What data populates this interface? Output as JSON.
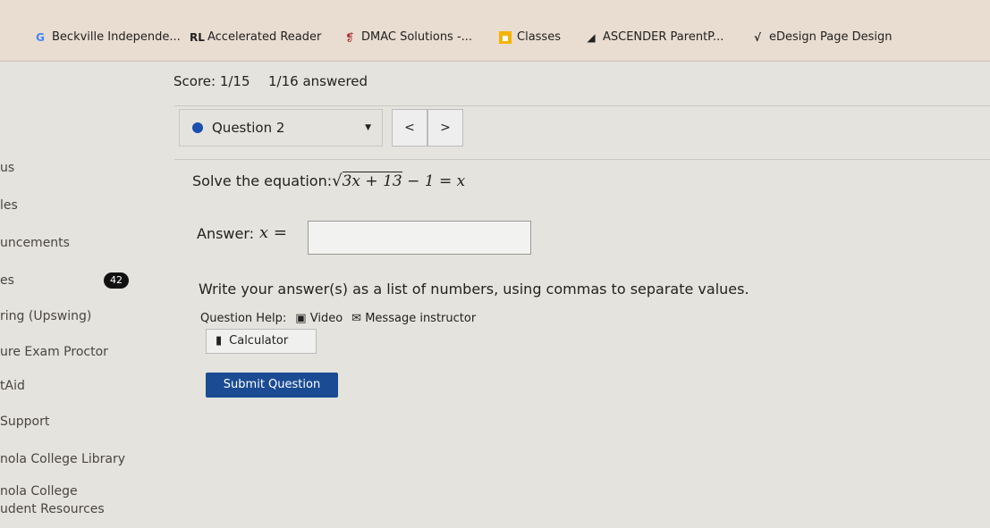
{
  "bookmarks": [
    {
      "label": "Beckville Independe...",
      "icon": "google-icon"
    },
    {
      "label": "Accelerated Reader",
      "icon": "rl-icon"
    },
    {
      "label": "DMAC Solutions -...",
      "icon": "dmac-icon"
    },
    {
      "label": "Classes",
      "icon": "classroom-icon"
    },
    {
      "label": "ASCENDER ParentP...",
      "icon": "ascender-icon"
    },
    {
      "label": "eDesign Page Design",
      "icon": "sqrt-icon"
    }
  ],
  "sidebar": {
    "items": [
      "us",
      "les",
      "uncements",
      "es",
      "ring (Upswing)",
      "ure Exam Proctor",
      "tAid",
      "Support",
      "nola College Library",
      "nola College",
      "udent Resources"
    ],
    "badge": "42"
  },
  "quiz": {
    "score": "Score: 1/15",
    "answered": "1/16 answered",
    "question": "Question 2",
    "prev": "<",
    "next": ">",
    "prompt": "Solve the equation:",
    "equation_left": "3x + 13",
    "equation_right": " − 1 = x",
    "answer_label": "Answer:",
    "answer_var": "x =",
    "answer_value": "",
    "instruction": "Write your answer(s) as a list of numbers, using commas to separate values.",
    "help_label": "Question Help:",
    "video": "Video",
    "message": "Message instructor",
    "calculator": "Calculator",
    "submit": "Submit Question"
  }
}
